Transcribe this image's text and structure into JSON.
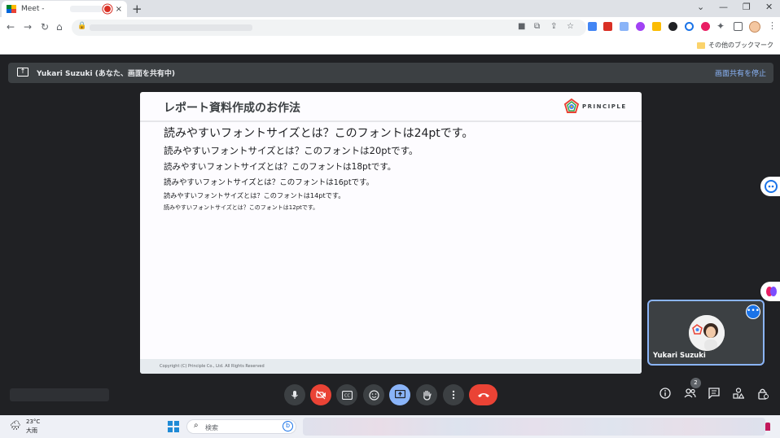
{
  "browser": {
    "tab_title": "Meet -",
    "tab_close": "×",
    "new_tab": "+",
    "bookmark_folder": "その他のブックマーク"
  },
  "meet": {
    "presenter_text": "Yukari Suzuki (あなた、画面を共有中)",
    "stop_share": "画面共有を停止",
    "self_name": "Yukari Suzuki",
    "participant_count": "2"
  },
  "slide": {
    "title": "レポート資料作成のお作法",
    "logo_text": "PRINCIPLE",
    "lines": [
      "読みやすいフォントサイズとは？このフォントは24ptです。",
      "読みやすいフォントサイズとは？このフォントは20ptです。",
      "読みやすいフォントサイズとは？このフォントは18ptです。",
      "読みやすいフォントサイズとは？このフォントは16ptです。",
      "読みやすいフォントサイズとは？このフォントは14ptです。",
      "読みやすいフォントサイズとは？このフォントは12ptです。"
    ],
    "copyright": "Copyright (C) Principle Co., Ltd. All Rights Reserved"
  },
  "taskbar": {
    "temperature": "23°C",
    "condition": "大雨",
    "search_placeholder": "検索"
  },
  "colors": {
    "meet_bg": "#202124",
    "accent_blue": "#8ab4f8",
    "end_call_red": "#ea4335"
  }
}
